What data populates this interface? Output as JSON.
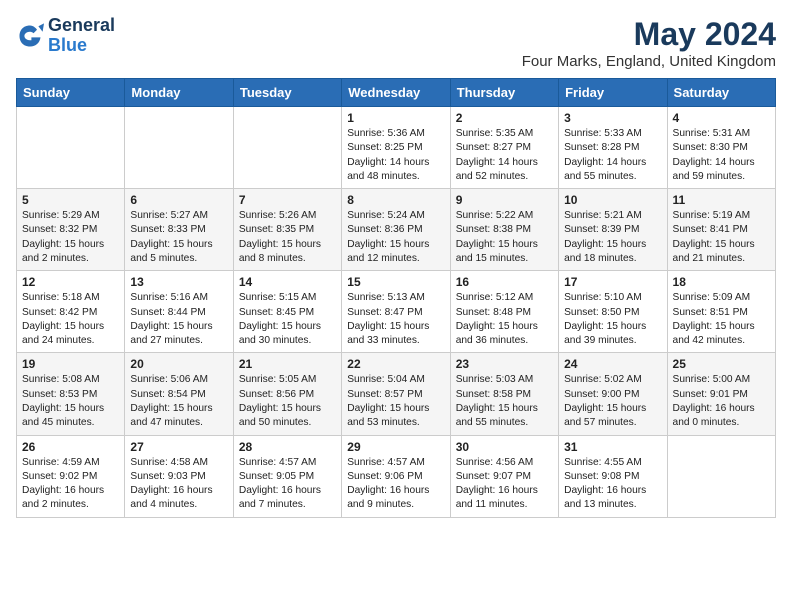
{
  "header": {
    "logo_general": "General",
    "logo_blue": "Blue",
    "month_year": "May 2024",
    "location": "Four Marks, England, United Kingdom"
  },
  "weekdays": [
    "Sunday",
    "Monday",
    "Tuesday",
    "Wednesday",
    "Thursday",
    "Friday",
    "Saturday"
  ],
  "weeks": [
    [
      {
        "day": "",
        "info": ""
      },
      {
        "day": "",
        "info": ""
      },
      {
        "day": "",
        "info": ""
      },
      {
        "day": "1",
        "info": "Sunrise: 5:36 AM\nSunset: 8:25 PM\nDaylight: 14 hours\nand 48 minutes."
      },
      {
        "day": "2",
        "info": "Sunrise: 5:35 AM\nSunset: 8:27 PM\nDaylight: 14 hours\nand 52 minutes."
      },
      {
        "day": "3",
        "info": "Sunrise: 5:33 AM\nSunset: 8:28 PM\nDaylight: 14 hours\nand 55 minutes."
      },
      {
        "day": "4",
        "info": "Sunrise: 5:31 AM\nSunset: 8:30 PM\nDaylight: 14 hours\nand 59 minutes."
      }
    ],
    [
      {
        "day": "5",
        "info": "Sunrise: 5:29 AM\nSunset: 8:32 PM\nDaylight: 15 hours\nand 2 minutes."
      },
      {
        "day": "6",
        "info": "Sunrise: 5:27 AM\nSunset: 8:33 PM\nDaylight: 15 hours\nand 5 minutes."
      },
      {
        "day": "7",
        "info": "Sunrise: 5:26 AM\nSunset: 8:35 PM\nDaylight: 15 hours\nand 8 minutes."
      },
      {
        "day": "8",
        "info": "Sunrise: 5:24 AM\nSunset: 8:36 PM\nDaylight: 15 hours\nand 12 minutes."
      },
      {
        "day": "9",
        "info": "Sunrise: 5:22 AM\nSunset: 8:38 PM\nDaylight: 15 hours\nand 15 minutes."
      },
      {
        "day": "10",
        "info": "Sunrise: 5:21 AM\nSunset: 8:39 PM\nDaylight: 15 hours\nand 18 minutes."
      },
      {
        "day": "11",
        "info": "Sunrise: 5:19 AM\nSunset: 8:41 PM\nDaylight: 15 hours\nand 21 minutes."
      }
    ],
    [
      {
        "day": "12",
        "info": "Sunrise: 5:18 AM\nSunset: 8:42 PM\nDaylight: 15 hours\nand 24 minutes."
      },
      {
        "day": "13",
        "info": "Sunrise: 5:16 AM\nSunset: 8:44 PM\nDaylight: 15 hours\nand 27 minutes."
      },
      {
        "day": "14",
        "info": "Sunrise: 5:15 AM\nSunset: 8:45 PM\nDaylight: 15 hours\nand 30 minutes."
      },
      {
        "day": "15",
        "info": "Sunrise: 5:13 AM\nSunset: 8:47 PM\nDaylight: 15 hours\nand 33 minutes."
      },
      {
        "day": "16",
        "info": "Sunrise: 5:12 AM\nSunset: 8:48 PM\nDaylight: 15 hours\nand 36 minutes."
      },
      {
        "day": "17",
        "info": "Sunrise: 5:10 AM\nSunset: 8:50 PM\nDaylight: 15 hours\nand 39 minutes."
      },
      {
        "day": "18",
        "info": "Sunrise: 5:09 AM\nSunset: 8:51 PM\nDaylight: 15 hours\nand 42 minutes."
      }
    ],
    [
      {
        "day": "19",
        "info": "Sunrise: 5:08 AM\nSunset: 8:53 PM\nDaylight: 15 hours\nand 45 minutes."
      },
      {
        "day": "20",
        "info": "Sunrise: 5:06 AM\nSunset: 8:54 PM\nDaylight: 15 hours\nand 47 minutes."
      },
      {
        "day": "21",
        "info": "Sunrise: 5:05 AM\nSunset: 8:56 PM\nDaylight: 15 hours\nand 50 minutes."
      },
      {
        "day": "22",
        "info": "Sunrise: 5:04 AM\nSunset: 8:57 PM\nDaylight: 15 hours\nand 53 minutes."
      },
      {
        "day": "23",
        "info": "Sunrise: 5:03 AM\nSunset: 8:58 PM\nDaylight: 15 hours\nand 55 minutes."
      },
      {
        "day": "24",
        "info": "Sunrise: 5:02 AM\nSunset: 9:00 PM\nDaylight: 15 hours\nand 57 minutes."
      },
      {
        "day": "25",
        "info": "Sunrise: 5:00 AM\nSunset: 9:01 PM\nDaylight: 16 hours\nand 0 minutes."
      }
    ],
    [
      {
        "day": "26",
        "info": "Sunrise: 4:59 AM\nSunset: 9:02 PM\nDaylight: 16 hours\nand 2 minutes."
      },
      {
        "day": "27",
        "info": "Sunrise: 4:58 AM\nSunset: 9:03 PM\nDaylight: 16 hours\nand 4 minutes."
      },
      {
        "day": "28",
        "info": "Sunrise: 4:57 AM\nSunset: 9:05 PM\nDaylight: 16 hours\nand 7 minutes."
      },
      {
        "day": "29",
        "info": "Sunrise: 4:57 AM\nSunset: 9:06 PM\nDaylight: 16 hours\nand 9 minutes."
      },
      {
        "day": "30",
        "info": "Sunrise: 4:56 AM\nSunset: 9:07 PM\nDaylight: 16 hours\nand 11 minutes."
      },
      {
        "day": "31",
        "info": "Sunrise: 4:55 AM\nSunset: 9:08 PM\nDaylight: 16 hours\nand 13 minutes."
      },
      {
        "day": "",
        "info": ""
      }
    ]
  ]
}
